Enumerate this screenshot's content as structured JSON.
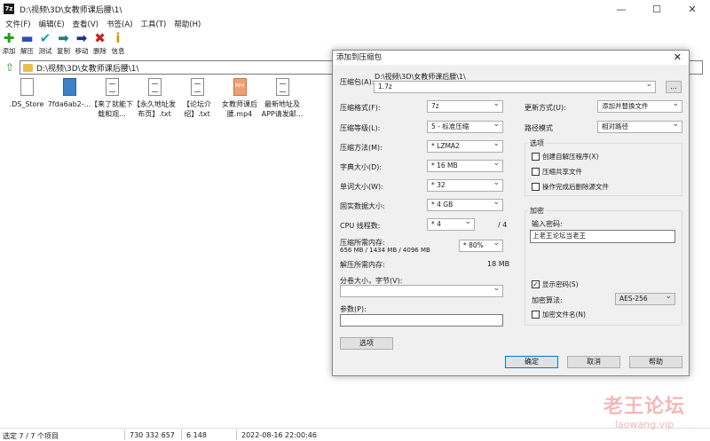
{
  "window": {
    "title": "D:\\视频\\3D\\女教师课后腰\\1\\"
  },
  "menu": [
    "文件(F)",
    "编辑(E)",
    "查看(V)",
    "书签(A)",
    "工具(T)",
    "帮助(H)"
  ],
  "toolbar": [
    {
      "label": "添加",
      "icon": "plus-icon",
      "glyph": "✚",
      "color": "#1e9e1e"
    },
    {
      "label": "解压",
      "icon": "minus-icon",
      "glyph": "▬",
      "color": "#2b4fb0"
    },
    {
      "label": "测试",
      "icon": "check-icon",
      "glyph": "✔",
      "color": "#17a2b8"
    },
    {
      "label": "复制",
      "icon": "copy-arrow-icon",
      "glyph": "➡",
      "color": "#1a7f7f"
    },
    {
      "label": "移动",
      "icon": "move-arrow-icon",
      "glyph": "➡",
      "color": "#1a2f8f"
    },
    {
      "label": "删除",
      "icon": "delete-x-icon",
      "glyph": "✖",
      "color": "#d11a1a"
    },
    {
      "label": "信息",
      "icon": "info-icon",
      "glyph": "i",
      "color": "#c9a000"
    }
  ],
  "address": {
    "path": "D:\\视频\\3D\\女教师课后腰\\1\\"
  },
  "files": [
    {
      "name": ".DS_Store",
      "type": "blank"
    },
    {
      "name": "7fda6ab2-...",
      "type": "img"
    },
    {
      "name": "【来了就能下载和观...",
      "type": "text"
    },
    {
      "name": "【永久地址发布页】.txt",
      "type": "text"
    },
    {
      "name": "【论坛介绍】.txt",
      "type": "text"
    },
    {
      "name": "女教师课后腰.mp4",
      "type": "mp4",
      "badge": "MP4"
    },
    {
      "name": "最新地址及APP请发邮...",
      "type": "text"
    }
  ],
  "status": {
    "selected": "选定 7 / 7 个项目",
    "size": "730 332 657",
    "packed": "6 148",
    "date": "2022-08-16 22:00:46"
  },
  "dialog": {
    "title": "添加到压缩包",
    "archive_label": "压缩包(A):",
    "archive_dir": "D:\\视频\\3D\\女教师课后腰\\1\\",
    "archive_name": "1.7z",
    "browse": "...",
    "format_label": "压缩格式(F):",
    "format": "7z",
    "level_label": "压缩等级(L):",
    "level": "5 - 标准压缩",
    "method_label": "压缩方法(M):",
    "method": "* LZMA2",
    "dict_label": "字典大小(D):",
    "dict": "* 16 MB",
    "word_label": "单词大小(W):",
    "word": "* 32",
    "solid_label": "固实数据大小:",
    "solid": "* 4 GB",
    "threads_label": "CPU 线程数:",
    "threads": "* 4",
    "threads_total": "/ 4",
    "mem_label": "压缩所需内存:",
    "mem_values": "656 MB / 1434 MB / 4096 MB",
    "mem_pct": "* 80%",
    "decomp_label": "解压所需内存:",
    "decomp_value": "18 MB",
    "split_label": "分卷大小，字节(V):",
    "params_label": "参数(P):",
    "options_button": "选项",
    "update_label": "更新方式(U):",
    "update": "添加并替换文件",
    "path_label": "路径模式",
    "path": "相对路径",
    "options_group": "选项",
    "opt_sfx": "创建自解压程序(X)",
    "opt_shared": "压缩共享文件",
    "opt_delete": "操作完成后删除源文件",
    "encrypt_group": "加密",
    "pwd_label": "输入密码:",
    "pwd_value": "上老王论坛当老王",
    "show_pwd": "显示密码(S)",
    "show_pwd_checked": "✓",
    "enc_method_label": "加密算法:",
    "enc_method": "AES-256",
    "enc_names": "加密文件名(N)",
    "ok": "确定",
    "cancel": "取消",
    "help": "帮助"
  },
  "watermark": {
    "line1": "老王论坛",
    "line2": "laowang.vip"
  }
}
